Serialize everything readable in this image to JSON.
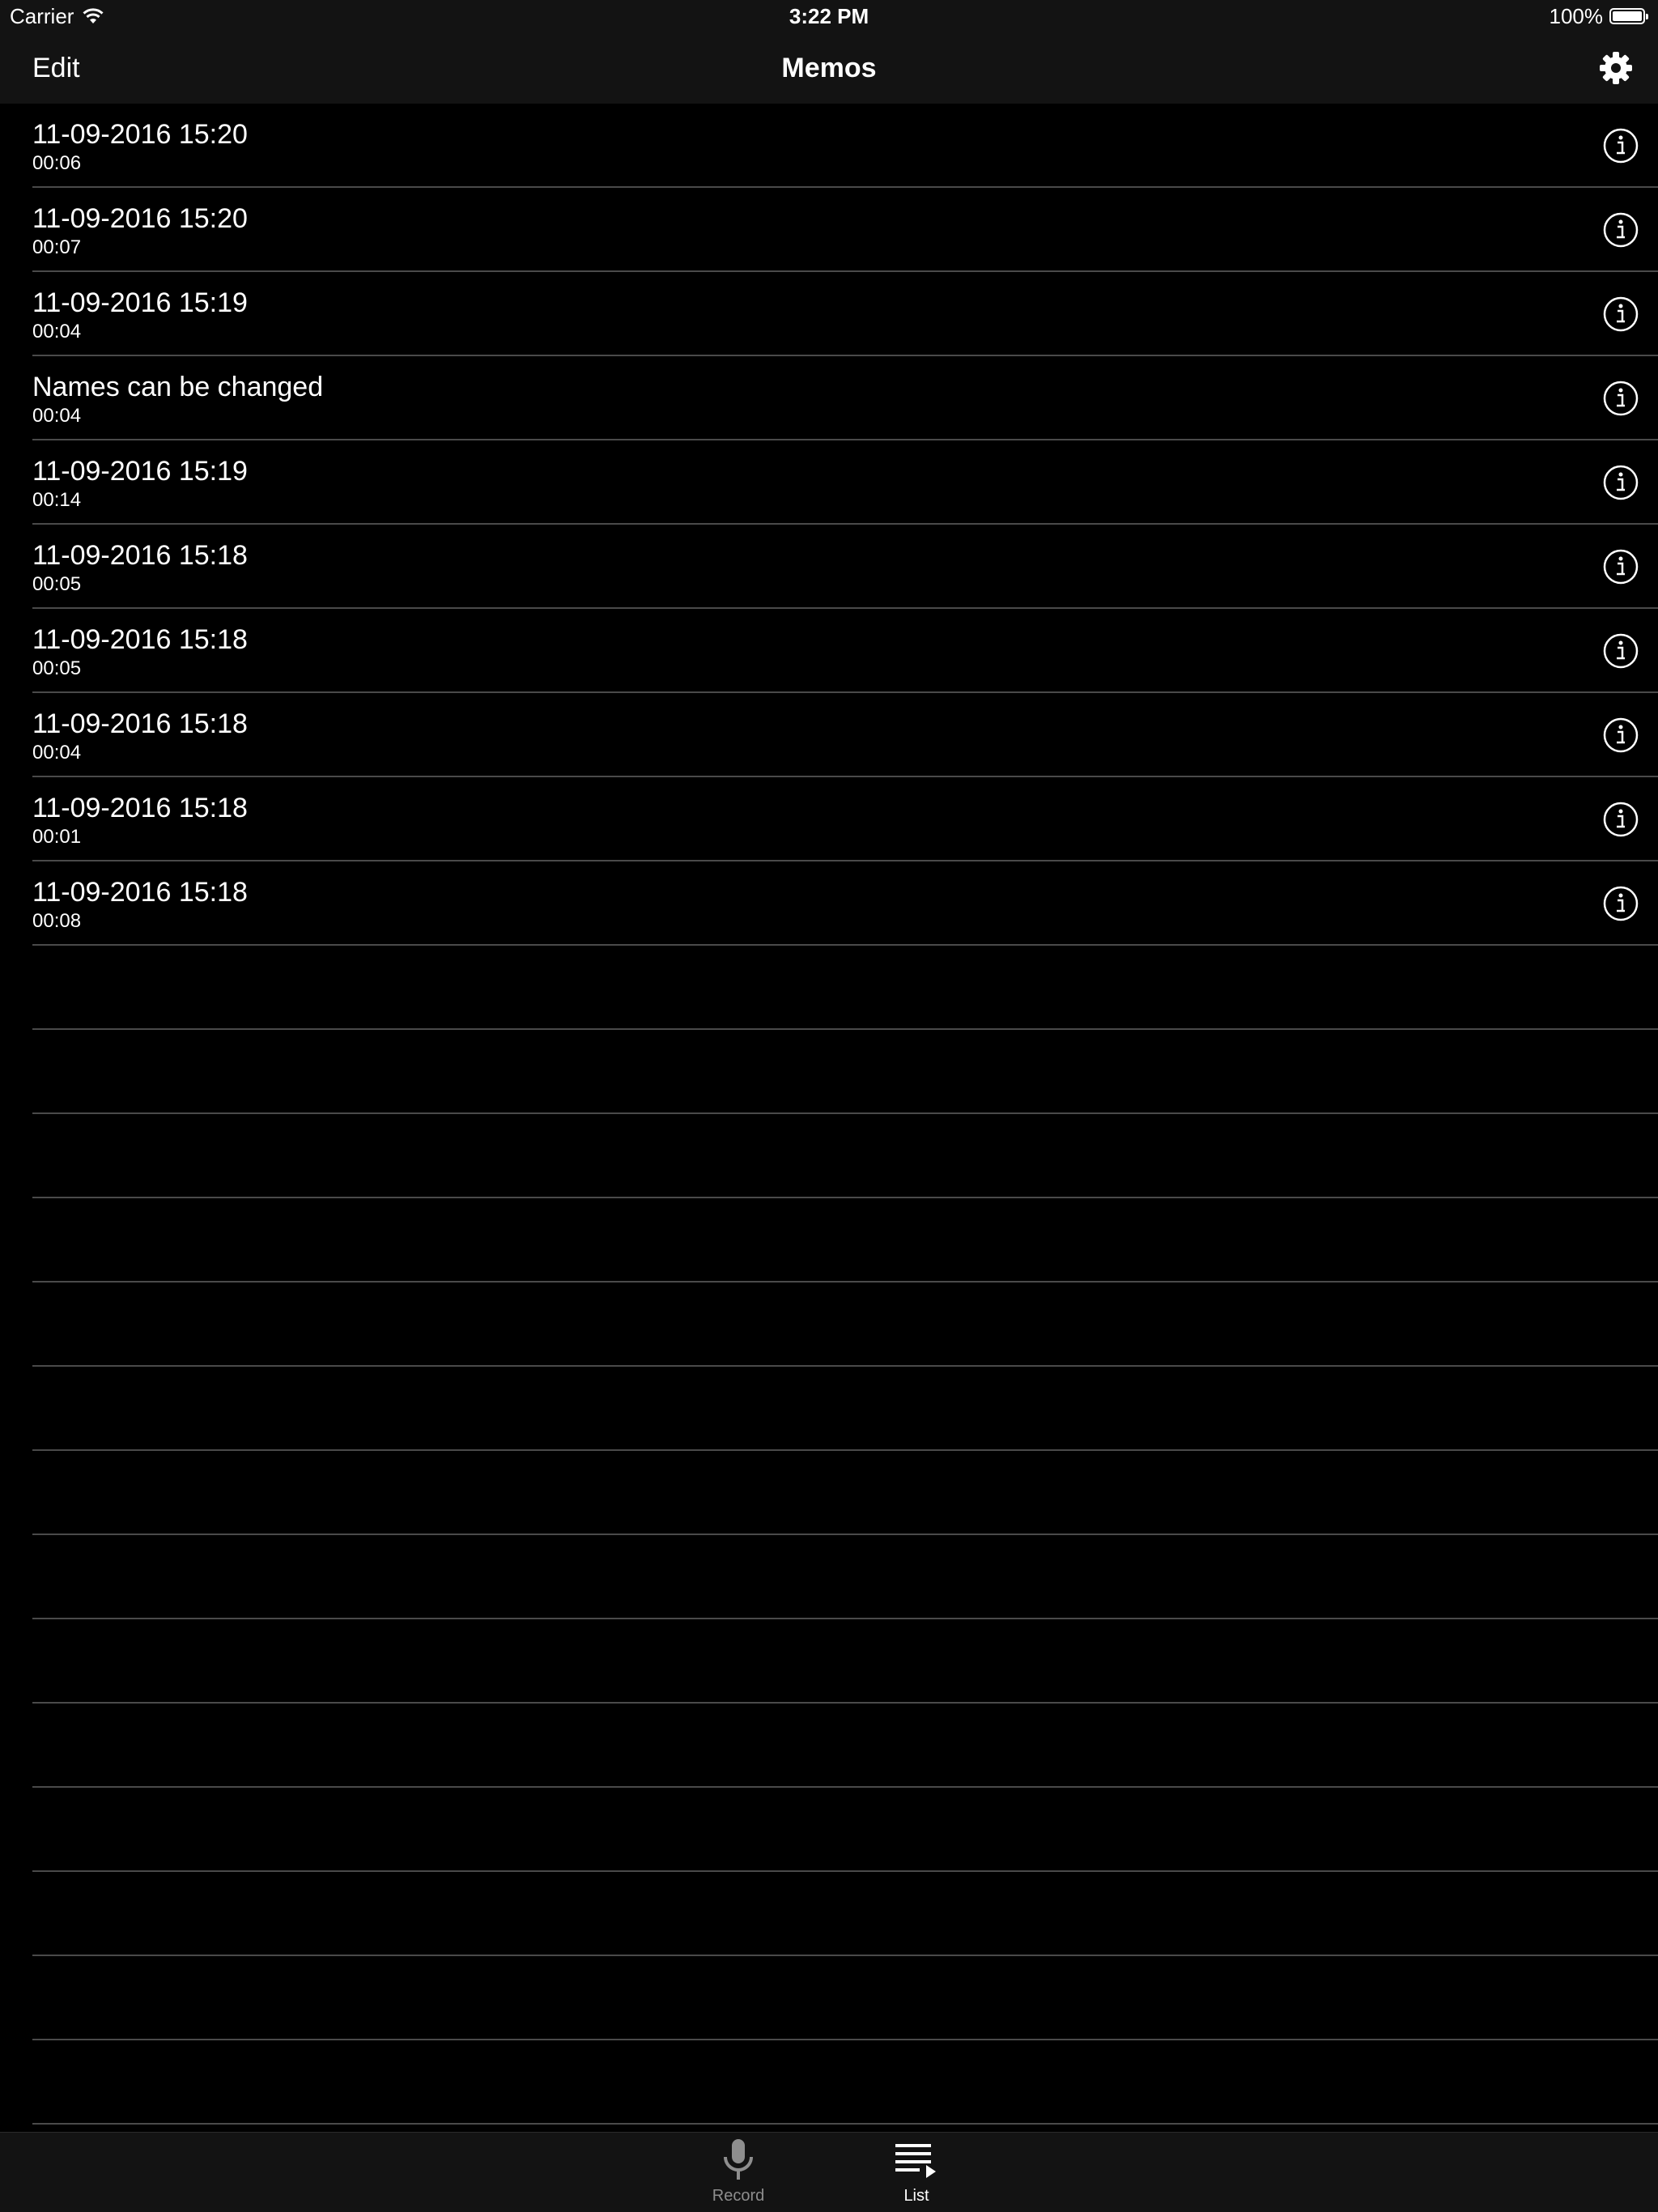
{
  "status_bar": {
    "carrier": "Carrier",
    "time": "3:22 PM",
    "battery": "100%",
    "battery_level": 1.0
  },
  "nav": {
    "edit_label": "Edit",
    "title": "Memos",
    "settings_icon": "gear-icon"
  },
  "memos": [
    {
      "title": "11-09-2016 15:20",
      "duration": "00:06"
    },
    {
      "title": "11-09-2016 15:20",
      "duration": "00:07"
    },
    {
      "title": "11-09-2016 15:19",
      "duration": "00:04"
    },
    {
      "title": "Names can be changed",
      "duration": "00:04"
    },
    {
      "title": "11-09-2016 15:19",
      "duration": "00:14"
    },
    {
      "title": "11-09-2016 15:18",
      "duration": "00:05"
    },
    {
      "title": "11-09-2016 15:18",
      "duration": "00:05"
    },
    {
      "title": "11-09-2016 15:18",
      "duration": "00:04"
    },
    {
      "title": "11-09-2016 15:18",
      "duration": "00:01"
    },
    {
      "title": "11-09-2016 15:18",
      "duration": "00:08"
    }
  ],
  "tabs": [
    {
      "label": "Record",
      "icon": "microphone-icon",
      "selected": false
    },
    {
      "label": "List",
      "icon": "playlist-icon",
      "selected": true
    }
  ],
  "colors": {
    "background": "#000000",
    "bar_background": "#131313",
    "separator": "#4a4a4a",
    "text": "#ffffff",
    "tab_inactive": "#8e8e8e",
    "tab_active": "#ffffff"
  }
}
